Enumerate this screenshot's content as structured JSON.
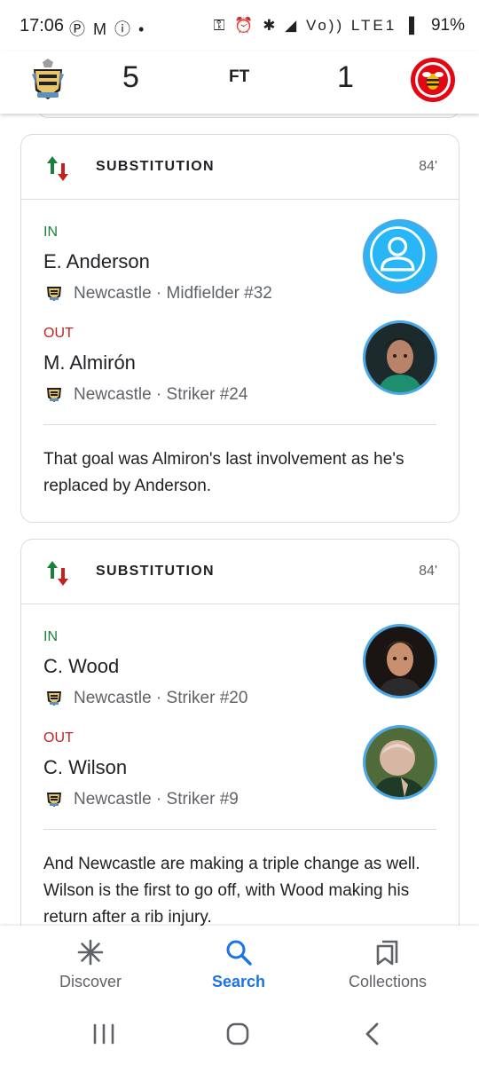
{
  "status_bar": {
    "time": "17:06",
    "left_icons": "Ⓟ M ⓘ •",
    "right_icons": "⚿ ⏰ ✱ ◢ Vo)) LTE1 ▐",
    "battery": "91%"
  },
  "score_header": {
    "home_team": "Newcastle",
    "away_team": "Brentford",
    "home_score": "5",
    "away_score": "1",
    "status": "FT"
  },
  "events": [
    {
      "title": "SUBSTITUTION",
      "minute": "84'",
      "in": {
        "tag": "IN",
        "name": "E. Anderson",
        "meta": "Newcastle · Midfielder #32",
        "photo": "placeholder"
      },
      "out": {
        "tag": "OUT",
        "name": "M. Almirón",
        "meta": "Newcastle · Striker #24",
        "photo": "photo"
      },
      "commentary": "That goal was Almiron's last involvement as he's replaced by Anderson."
    },
    {
      "title": "SUBSTITUTION",
      "minute": "84'",
      "in": {
        "tag": "IN",
        "name": "C. Wood",
        "meta": "Newcastle · Striker #20",
        "photo": "photo"
      },
      "out": {
        "tag": "OUT",
        "name": "C. Wilson",
        "meta": "Newcastle · Striker #9",
        "photo": "photo"
      },
      "commentary": "And Newcastle are making a triple change as well. Wilson is the first to go off, with Wood making his return after a rib injury."
    }
  ],
  "bottom_nav": [
    {
      "label": "Discover",
      "icon": "asterisk-icon",
      "active": false
    },
    {
      "label": "Search",
      "icon": "search-icon",
      "active": true
    },
    {
      "label": "Collections",
      "icon": "bookmarks-icon",
      "active": false
    }
  ],
  "colors": {
    "accent": "#1a73e8",
    "in": "#188038",
    "out": "#c5221f",
    "avatar_ring": "#4aa8e8",
    "placeholder_avatar": "#29b6f6"
  }
}
